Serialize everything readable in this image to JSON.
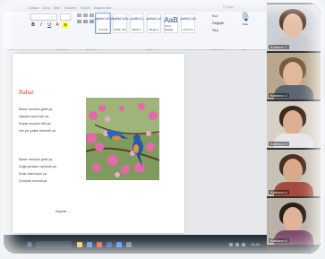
{
  "ribbon": {
    "menu_tabs": [
      "Dosya",
      "Giriş",
      "Ekle",
      "Tasarım",
      "Düzen",
      "Başvurular"
    ],
    "share_label": "Paylaş",
    "styles": [
      {
        "sample": "AaBbCcDc",
        "name": "Normal"
      },
      {
        "sample": "AaBbCcDc",
        "name": "Aralık Yok"
      },
      {
        "sample": "AaBbCc",
        "name": "Başlık 1"
      },
      {
        "sample": "AaBbCcC",
        "name": "Başlık 2"
      },
      {
        "sample": "AaB",
        "name": "Konu Başlığı"
      },
      {
        "sample": "AaBbCcD",
        "name": "Alt Konu"
      }
    ],
    "editing": [
      "Bul",
      "Değiştir",
      "Seç"
    ],
    "dictate_label": "Dikte",
    "group_labels": [
      "Pano",
      "Yazı Tipi",
      "Paragraf",
      "Stiller",
      "Düzenleme",
      "Ses"
    ]
  },
  "document": {
    "title": "Bahar",
    "stanza1": [
      "Bahar mevsimi geldi ya,",
      "Ağaçlar çiçek açtı ya,",
      "Kuşlar neşeyle öttü ya,",
      "Her yer yeşile büründü ya."
    ],
    "stanza2": [
      "Bahar mevsimi geldi ya,",
      "Doğa yeniden canlandı ya,",
      "Arılar bala koştu ya,",
      "Çocuklar sevindi ya."
    ],
    "author": "Kaynak: ...",
    "image_subject": "two blue birds on pink blossom branch"
  },
  "taskbar": {
    "clock": "11:42"
  },
  "participants": [
    {
      "name": "Kullanıcı 1",
      "skin": "#e5bfa6",
      "hair": "#5a3a2a",
      "shirt": "#c9c9cf",
      "bg": "#cbd0d6"
    },
    {
      "name": "Katılımcı 2",
      "skin": "#e2b89c",
      "hair": "#7a5a3e",
      "shirt": "#5d6670",
      "bg": "#b8a78c"
    },
    {
      "name": "Katılımcı 3",
      "skin": "#dcae92",
      "hair": "#3b2a20",
      "shirt": "#e6e6ea",
      "bg": "#d7d0c6"
    },
    {
      "name": "Katılımcı 4",
      "skin": "#d9a98c",
      "hair": "#4a2e22",
      "shirt": "#a24c3f",
      "bg": "#c8c2b6"
    },
    {
      "name": "Katılımcı 5",
      "skin": "#e0b39a",
      "hair": "#2b1d17",
      "shirt": "#7d4a6a",
      "bg": "#b9b1a8"
    }
  ],
  "colors": {
    "title_red": "#d43a2b",
    "word_blue": "#2b579a",
    "taskbar": "#1c2531"
  }
}
